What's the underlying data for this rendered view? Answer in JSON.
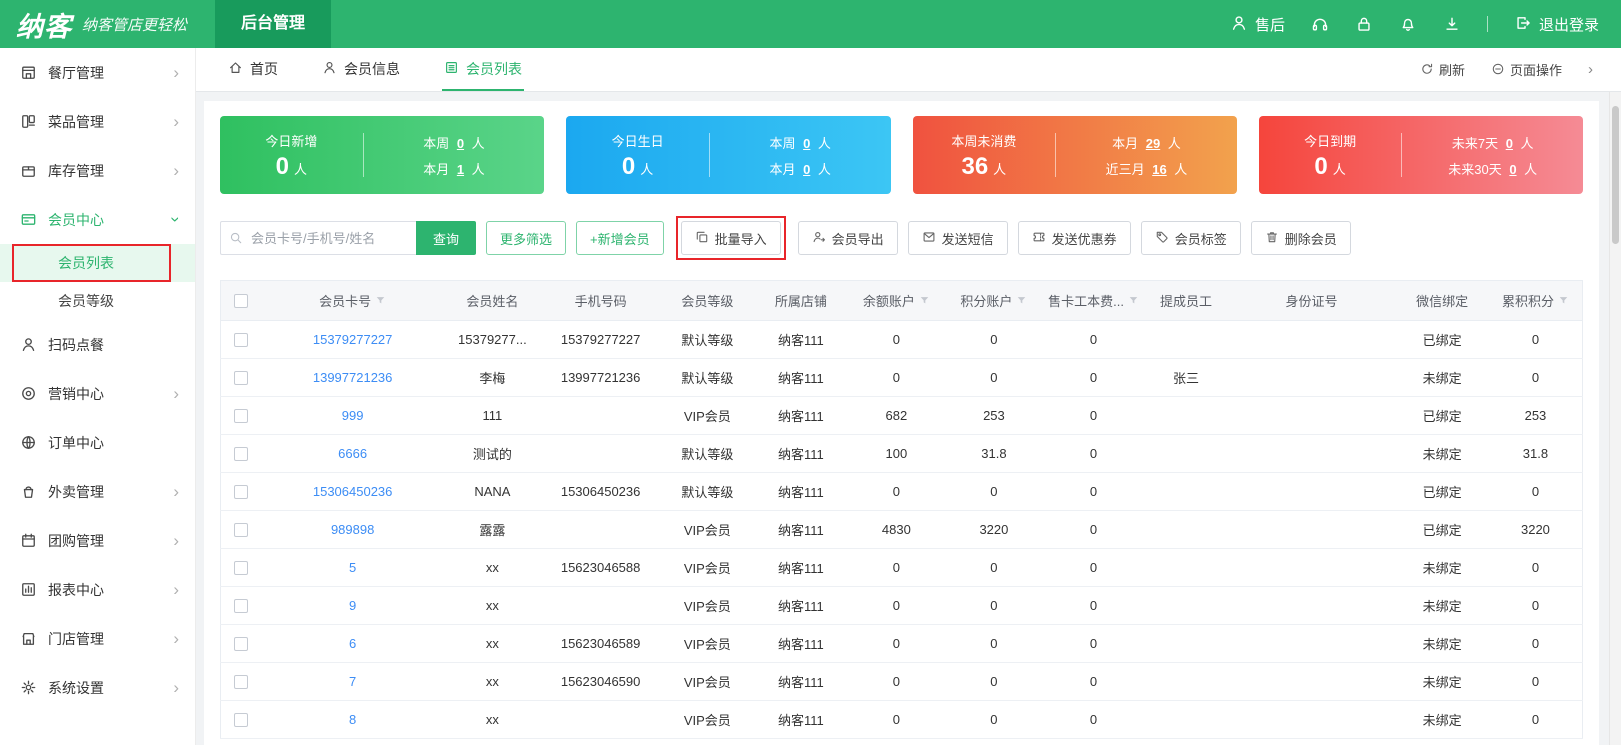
{
  "app": {
    "logo_text": "纳客",
    "slogan": "纳客管店更轻松",
    "nav_tab": "后台管理"
  },
  "colors": {
    "accent_green": "#2db46f",
    "annotation_red": "#e8252a",
    "link_blue": "#3d8df5"
  },
  "header_right": {
    "after_sales": "售后",
    "logout": "退出登录"
  },
  "sidebar": {
    "items": [
      {
        "id": "restaurant",
        "icon": "restaurant",
        "label": "餐厅管理",
        "chevron": true
      },
      {
        "id": "dishes",
        "icon": "dish",
        "label": "菜品管理",
        "chevron": true
      },
      {
        "id": "inventory",
        "icon": "inventory",
        "label": "库存管理",
        "chevron": true
      },
      {
        "id": "member-center",
        "icon": "member",
        "label": "会员中心",
        "chevron": true,
        "expanded": true,
        "active": true,
        "children": [
          {
            "id": "member-list",
            "label": "会员列表",
            "active": true,
            "annotated": true
          },
          {
            "id": "member-level",
            "label": "会员等级"
          }
        ]
      },
      {
        "id": "scan-order",
        "icon": "scan",
        "label": "扫码点餐"
      },
      {
        "id": "marketing",
        "icon": "marketing",
        "label": "营销中心",
        "chevron": true
      },
      {
        "id": "order-center",
        "icon": "order",
        "label": "订单中心"
      },
      {
        "id": "takeout",
        "icon": "takeout",
        "label": "外卖管理",
        "chevron": true
      },
      {
        "id": "groupbuy",
        "icon": "groupbuy",
        "label": "团购管理",
        "chevron": true
      },
      {
        "id": "reports",
        "icon": "report",
        "label": "报表中心",
        "chevron": true
      },
      {
        "id": "stores",
        "icon": "store",
        "label": "门店管理",
        "chevron": true
      },
      {
        "id": "settings",
        "icon": "settings",
        "label": "系统设置",
        "chevron": true
      }
    ]
  },
  "tabs": {
    "items": [
      {
        "id": "home",
        "icon": "home",
        "label": "首页"
      },
      {
        "id": "member-info",
        "icon": "user",
        "label": "会员信息"
      },
      {
        "id": "member-list",
        "icon": "memberlist",
        "label": "会员列表",
        "active": true
      }
    ],
    "actions": {
      "refresh": "刷新",
      "page_ops": "页面操作"
    }
  },
  "stats_cards": [
    {
      "id": "new-today",
      "title": "今日新增",
      "value": "0",
      "unit": "人",
      "gradient": [
        "#2fc060",
        "#5ad489"
      ],
      "lines": [
        {
          "label": "本周",
          "value": "0",
          "unit": "人"
        },
        {
          "label": "本月",
          "value": "1",
          "unit": "人"
        }
      ]
    },
    {
      "id": "birthday-today",
      "title": "今日生日",
      "value": "0",
      "unit": "人",
      "gradient": [
        "#1ba8f0",
        "#3cc6f4"
      ],
      "lines": [
        {
          "label": "本周",
          "value": "0",
          "unit": "人"
        },
        {
          "label": "本月",
          "value": "0",
          "unit": "人"
        }
      ]
    },
    {
      "id": "no-consume-week",
      "title": "本周未消费",
      "value": "36",
      "unit": "人",
      "gradient": [
        "#f0523f",
        "#f2a24d"
      ],
      "lines": [
        {
          "label": "本月",
          "value": "29",
          "unit": "人"
        },
        {
          "label": "近三月",
          "value": "16",
          "unit": "人"
        }
      ]
    },
    {
      "id": "expire-today",
      "title": "今日到期",
      "value": "0",
      "unit": "人",
      "gradient": [
        "#f5453c",
        "#f58b95"
      ],
      "lines": [
        {
          "label": "未来7天",
          "value": "0",
          "unit": "人"
        },
        {
          "label": "未来30天",
          "value": "0",
          "unit": "人"
        }
      ]
    }
  ],
  "toolbar": {
    "search_placeholder": "会员卡号/手机号/姓名",
    "search_button": "查询",
    "buttons": [
      {
        "id": "more-filter",
        "label": "更多筛选",
        "style": "green-outline"
      },
      {
        "id": "add-member",
        "label": "+新增会员",
        "style": "green-outline"
      },
      {
        "id": "batch-import",
        "label": "批量导入",
        "icon": "batchimport",
        "annotated": true
      },
      {
        "id": "member-export",
        "label": "会员导出",
        "icon": "export"
      },
      {
        "id": "send-sms",
        "label": "发送短信",
        "icon": "sms"
      },
      {
        "id": "send-coupon",
        "label": "发送优惠券",
        "icon": "coupon"
      },
      {
        "id": "member-tag",
        "label": "会员标签",
        "icon": "tag"
      },
      {
        "id": "delete-member",
        "label": "删除会员",
        "icon": "delete"
      }
    ]
  },
  "table": {
    "columns": [
      {
        "label": "会员卡号",
        "sortable": true
      },
      {
        "label": "会员姓名"
      },
      {
        "label": "手机号码"
      },
      {
        "label": "会员等级"
      },
      {
        "label": "所属店铺"
      },
      {
        "label": "余额账户",
        "sortable": true
      },
      {
        "label": "积分账户",
        "sortable": true
      },
      {
        "label": "售卡工本费...",
        "sortable": true
      },
      {
        "label": "提成员工"
      },
      {
        "label": "身份证号"
      },
      {
        "label": "微信绑定"
      },
      {
        "label": "累积积分",
        "sortable": true
      }
    ],
    "rows": [
      [
        "15379277227",
        "15379277...",
        "15379277227",
        "默认等级",
        "纳客111",
        "0",
        "0",
        "0",
        "",
        "",
        "已绑定",
        "0"
      ],
      [
        "13997721236",
        "李梅",
        "13997721236",
        "默认等级",
        "纳客111",
        "0",
        "0",
        "0",
        "张三",
        "",
        "未绑定",
        "0"
      ],
      [
        "999",
        "111",
        "",
        "VIP会员",
        "纳客111",
        "682",
        "253",
        "0",
        "",
        "",
        "已绑定",
        "253"
      ],
      [
        "6666",
        "测试的",
        "",
        "默认等级",
        "纳客111",
        "100",
        "31.8",
        "0",
        "",
        "",
        "未绑定",
        "31.8"
      ],
      [
        "15306450236",
        "NANA",
        "15306450236",
        "默认等级",
        "纳客111",
        "0",
        "0",
        "0",
        "",
        "",
        "已绑定",
        "0"
      ],
      [
        "989898",
        "露露",
        "",
        "VIP会员",
        "纳客111",
        "4830",
        "3220",
        "0",
        "",
        "",
        "已绑定",
        "3220"
      ],
      [
        "5",
        "xx",
        "15623046588",
        "VIP会员",
        "纳客111",
        "0",
        "0",
        "0",
        "",
        "",
        "未绑定",
        "0"
      ],
      [
        "9",
        "xx",
        "",
        "VIP会员",
        "纳客111",
        "0",
        "0",
        "0",
        "",
        "",
        "未绑定",
        "0"
      ],
      [
        "6",
        "xx",
        "15623046589",
        "VIP会员",
        "纳客111",
        "0",
        "0",
        "0",
        "",
        "",
        "未绑定",
        "0"
      ],
      [
        "7",
        "xx",
        "15623046590",
        "VIP会员",
        "纳客111",
        "0",
        "0",
        "0",
        "",
        "",
        "未绑定",
        "0"
      ],
      [
        "8",
        "xx",
        "",
        "VIP会员",
        "纳客111",
        "0",
        "0",
        "0",
        "",
        "",
        "未绑定",
        "0"
      ]
    ]
  }
}
